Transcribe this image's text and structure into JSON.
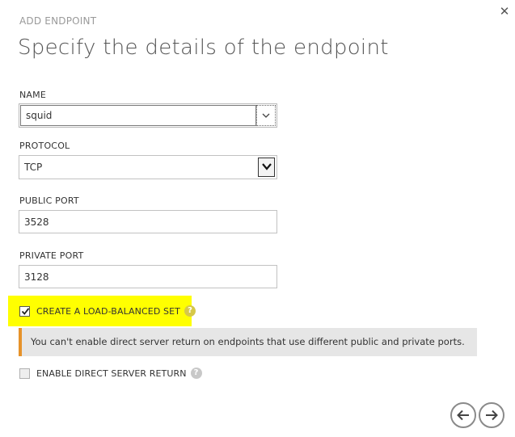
{
  "dialog": {
    "kicker": "ADD ENDPOINT",
    "title": "Specify the details of the endpoint",
    "close_glyph": "✕"
  },
  "form": {
    "name_label": "NAME",
    "name_value": "squid",
    "protocol_label": "PROTOCOL",
    "protocol_value": "TCP",
    "public_port_label": "PUBLIC PORT",
    "public_port_value": "3528",
    "private_port_label": "PRIVATE PORT",
    "private_port_value": "3128"
  },
  "options": {
    "load_balanced_label": "CREATE A LOAD-BALANCED SET",
    "load_balanced_checked": true,
    "direct_return_label": "ENABLE DIRECT SERVER RETURN",
    "direct_return_checked": false,
    "help_glyph": "?"
  },
  "info": {
    "message": "You can't enable direct server return on endpoints that use different public and private ports."
  },
  "navigation": {
    "back_icon": "arrow-left-icon",
    "next_icon": "arrow-right-icon"
  },
  "colors": {
    "highlight": "#ffff00",
    "info_accent": "#e6922a",
    "info_background": "#e6e6e6"
  }
}
